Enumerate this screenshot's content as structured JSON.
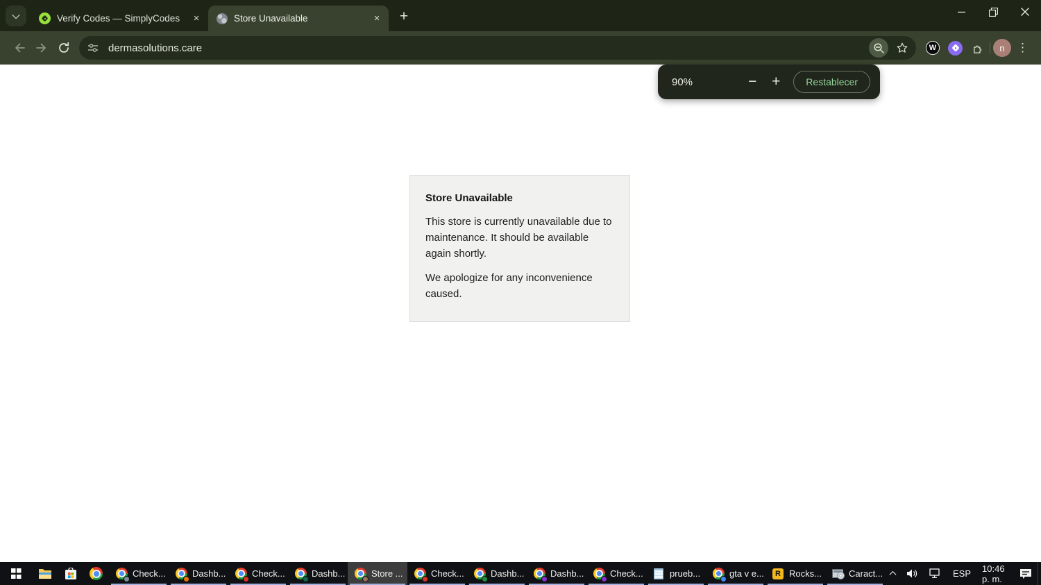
{
  "browser": {
    "tabs": [
      {
        "title": "Verify Codes — SimplyCodes",
        "favicon": "simplycodes-icon",
        "close_glyph": "×"
      },
      {
        "title": "Store Unavailable",
        "favicon": "globe-icon",
        "close_glyph": "×"
      }
    ],
    "new_tab_glyph": "+",
    "url": "dermasolutions.care",
    "extensions": {
      "w_letter": "W"
    },
    "profile_initial": "n",
    "menu_glyph": "⋮"
  },
  "zoom_popup": {
    "level": "90%",
    "decrease_glyph": "−",
    "increase_glyph": "+",
    "reset_label": "Restablecer"
  },
  "store_page": {
    "heading": "Store Unavailable",
    "paragraph1": "This store is currently unavailable due to maintenance. It should be available again shortly.",
    "paragraph2": "We apologize for any inconvenience caused."
  },
  "taskbar": {
    "apps": [
      {
        "label": "Check...",
        "icon": "chrome",
        "badge": "#7d8c99",
        "active": false
      },
      {
        "label": "Dashb...",
        "icon": "chrome",
        "badge": "#e8710a",
        "active": false
      },
      {
        "label": "Check...",
        "icon": "chrome",
        "badge": "#d93025",
        "active": false
      },
      {
        "label": "Dashb...",
        "icon": "chrome",
        "badge": "#14634a",
        "active": false
      },
      {
        "label": "Store ...",
        "icon": "chrome",
        "badge": "#9c6f62",
        "active": true
      },
      {
        "label": "Check...",
        "icon": "chrome",
        "badge": "#d93025",
        "active": false
      },
      {
        "label": "Dashb...",
        "icon": "chrome",
        "badge": "#1e8e3e",
        "active": false
      },
      {
        "label": "Dashb...",
        "icon": "chrome",
        "badge": "#8430ce",
        "active": false
      },
      {
        "label": "Check...",
        "icon": "chrome",
        "badge": "#8430ce",
        "active": false
      },
      {
        "label": "prueb...",
        "icon": "notepad",
        "badge": "",
        "active": false
      },
      {
        "label": "gta v e...",
        "icon": "chrome",
        "badge": "#4285f4",
        "active": false
      },
      {
        "label": "Rocks...",
        "icon": "rockstar",
        "badge": "",
        "active": false
      },
      {
        "label": "Caract...",
        "icon": "system",
        "badge": "",
        "active": false
      }
    ],
    "tray": {
      "language": "ESP",
      "time": "10:46 p. m."
    }
  },
  "colors": {
    "theme_dark": "#1e2517",
    "theme_toolbar": "#39422e",
    "omnibox": "#242d1d",
    "reset_green": "#93d49a",
    "simplycodes_green": "#98e13a",
    "extension_purple": "#8a6cf3",
    "avatar_brown": "#aa8076",
    "taskbar_black": "#101114",
    "taskbar_underline": "#a2afdd",
    "active_app_gray": "#3d3d3d"
  }
}
